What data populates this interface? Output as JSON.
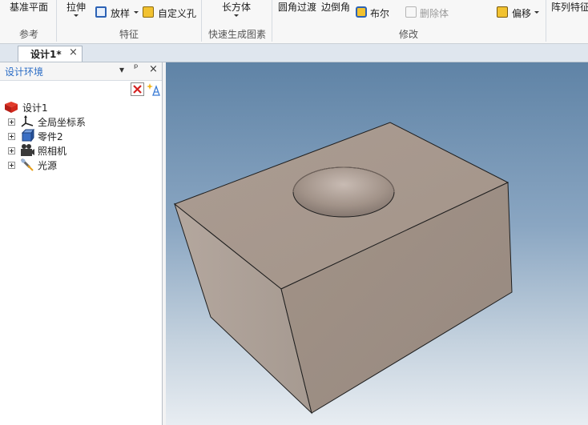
{
  "ribbon": {
    "ref_plane": "基准平面",
    "group_reference": "参考",
    "extrude": "拉伸",
    "loft": "放样",
    "custom_hole": "自定义孔",
    "group_features": "特征",
    "cuboid": "长方体",
    "group_quick": "快速生成图素",
    "fillet": "圆角过渡",
    "chamfer": "边倒角",
    "boolean": "布尔",
    "delete_body": "删除体",
    "offset": "偏移",
    "group_modify": "修改",
    "pattern": "阵列特征"
  },
  "tab": {
    "title": "设计1*",
    "close": "×"
  },
  "panel": {
    "title": "设计环境",
    "menu_glyph": "▾",
    "pin_glyph": "ᵖ",
    "close_glyph": "×",
    "tree": {
      "root": "设计1",
      "children": [
        "全局坐标系",
        "零件2",
        "照相机",
        "光源"
      ]
    }
  },
  "colors": {
    "accent_blue": "#2a6cc5",
    "model_face_top": "#a9998f",
    "model_face_front": "#9d8f85",
    "model_face_left": "#b0a39a"
  }
}
